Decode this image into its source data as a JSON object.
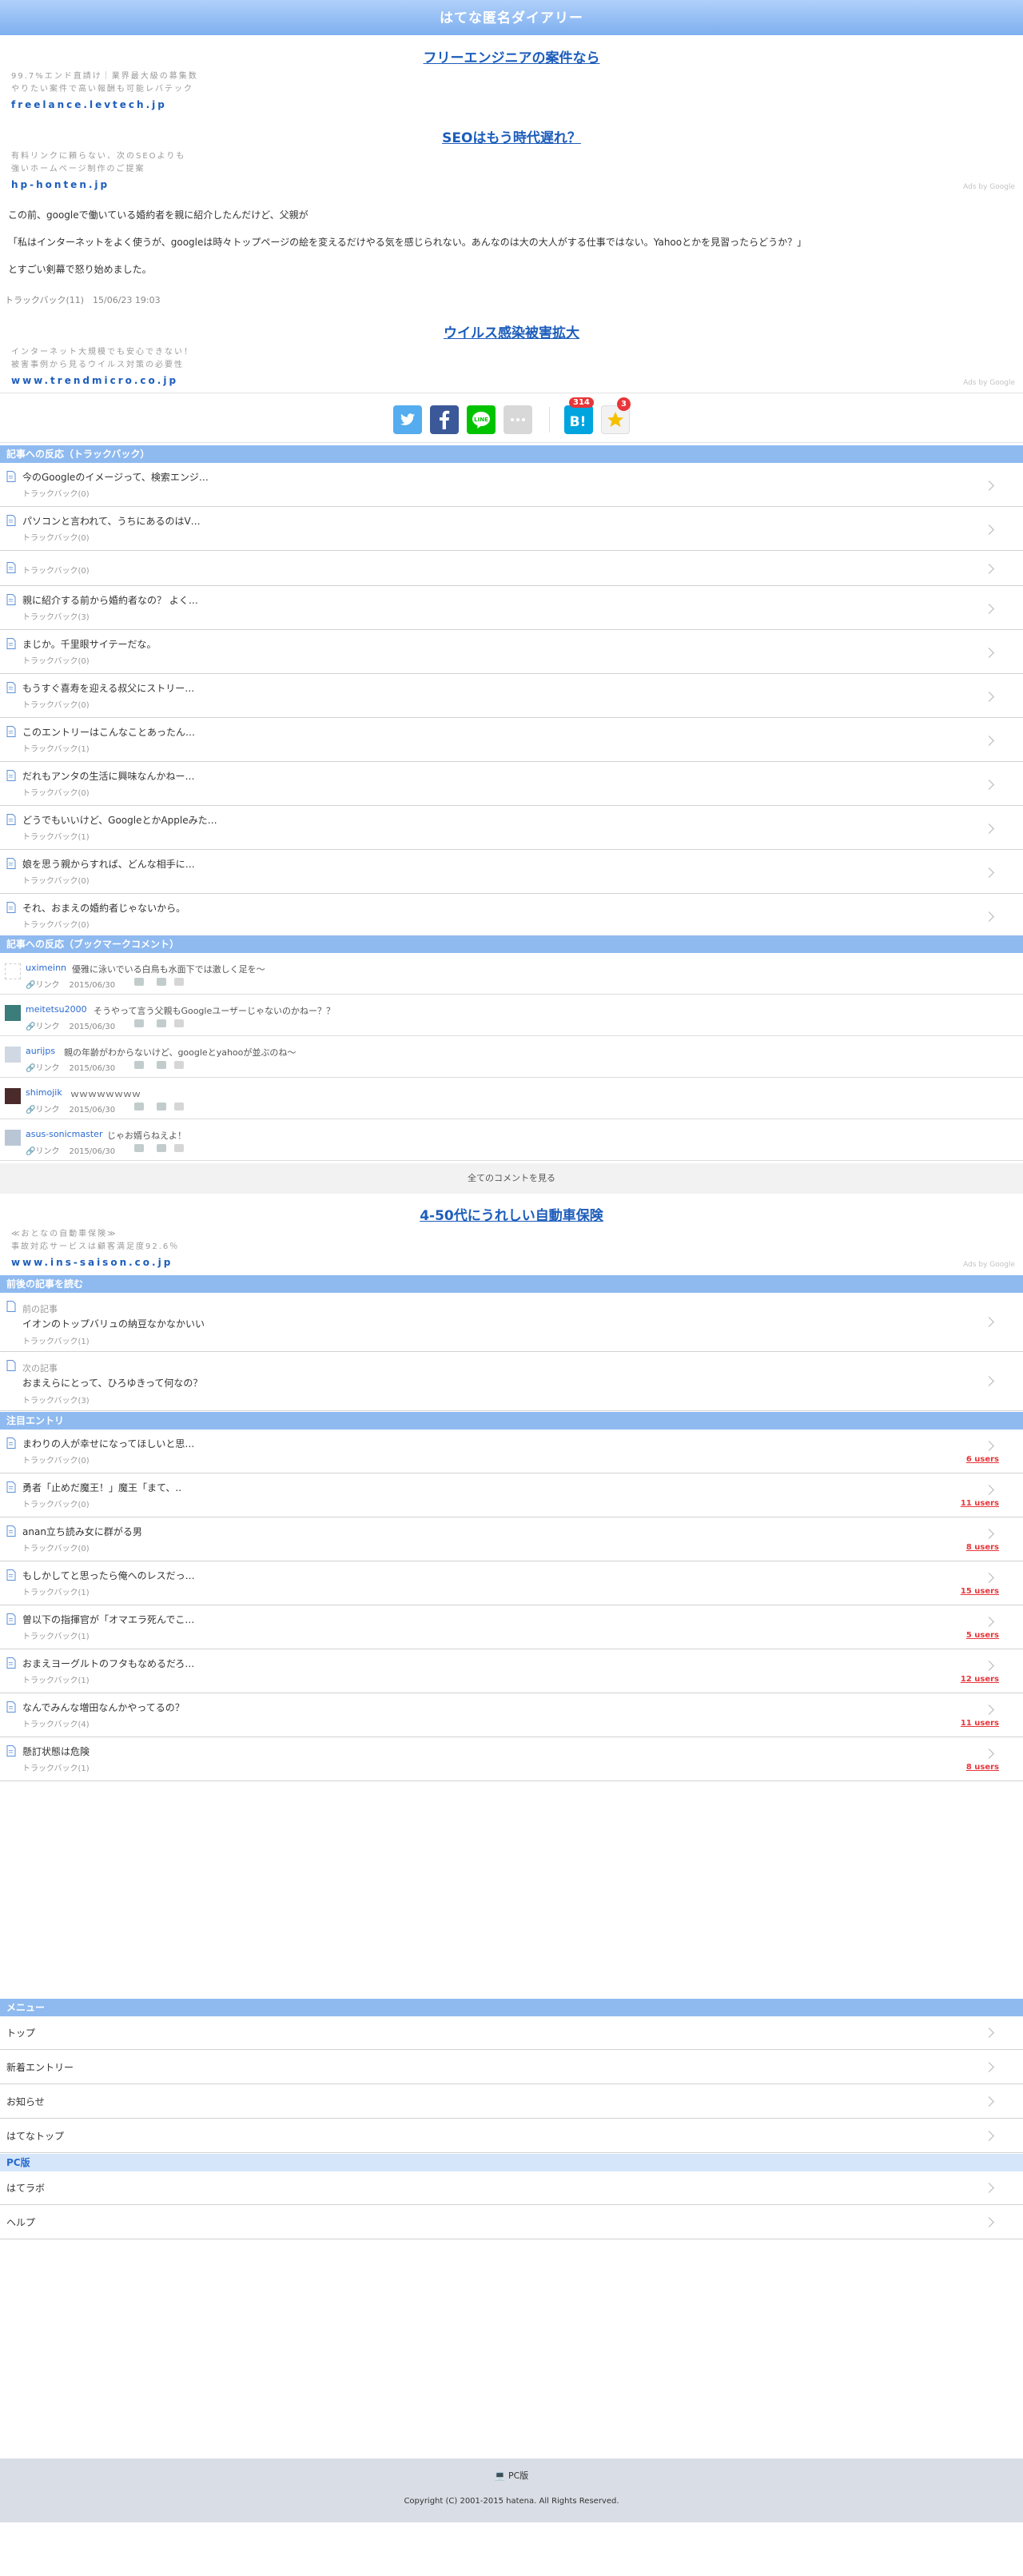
{
  "header": {
    "title": "はてな匿名ダイアリー"
  },
  "ads": [
    {
      "title": "フリーエンジニアの案件なら",
      "desc1": "99.7%エンド直請け｜業界最大級の募集数",
      "desc2": "やりたい案件で高い報酬も可能レバテック",
      "url": "freelance.levtech.jp"
    },
    {
      "title": "SEOはもう時代遅れ？",
      "desc1": "有料リンクに頼らない、次のSEOよりも",
      "desc2": "強いホームページ制作のご提案",
      "url": "hp-honten.jp",
      "label": "Ads by Google"
    },
    {
      "title": "ウイルス感染被害拡大",
      "desc1": "インターネット大規模でも安心できない！",
      "desc2": "被害事例から見るウイルス対策の必要性",
      "url": "www.trendmicro.co.jp",
      "label": "Ads by Google"
    },
    {
      "title": "4-50代にうれしい自動車保険",
      "desc1": "≪おとなの自動車保険≫",
      "desc2": "事故対応サービスは顧客満足度92.6％",
      "url": "www.ins-saison.co.jp",
      "label": "Ads by Google"
    }
  ],
  "entry": {
    "p1": "この前、googleで働いている婚約者を親に紹介したんだけど、父親が",
    "p2": "「私はインターネットをよく使うが、googleは時々トップページの絵を変えるだけやる気を感じられない。あんなのは大の大人がする仕事ではない。Yahooとかを見習ったらどうか？」",
    "p3": "とすごい剣幕で怒り始めました。",
    "meta": "トラックバック(11)　15/06/23 19:03"
  },
  "share": {
    "hatena_count": "314",
    "star_count": "3"
  },
  "trackback_section": {
    "heading": "記事への反応（トラックバック）",
    "items": [
      {
        "title": "今のGoogleのイメージって、検索エンジ…",
        "sub": "トラックバック(0)"
      },
      {
        "title": "パソコンと言われて、うちにあるのはV…",
        "sub": "トラックバック(0)"
      },
      {
        "title": "",
        "sub": "トラックバック(0)"
      },
      {
        "title": "親に紹介する前から婚約者なの？ よく…",
        "sub": "トラックバック(3)"
      },
      {
        "title": "まじか。千里眼サイテーだな。",
        "sub": "トラックバック(0)"
      },
      {
        "title": "もうすぐ喜寿を迎える叔父にストリー…",
        "sub": "トラックバック(0)"
      },
      {
        "title": "このエントリーはこんなことあったん…",
        "sub": "トラックバック(1)"
      },
      {
        "title": "だれもアンタの生活に興味なんかねー…",
        "sub": "トラックバック(0)"
      },
      {
        "title": "どうでもいいけど、GoogleとかAppleみた…",
        "sub": "トラックバック(1)"
      },
      {
        "title": "娘を思う親からすれば、どんな相手に…",
        "sub": "トラックバック(0)"
      },
      {
        "title": "それ、おまえの婚約者じゃないから。",
        "sub": "トラックバック(0)"
      }
    ]
  },
  "bookmark_section": {
    "heading": "記事への反応（ブックマークコメント）",
    "link_label": "リンク",
    "items": [
      {
        "user": "uximeinn",
        "comment": "優雅に泳いでいる白鳥も水面下では激しく足を～",
        "date": "2015/06/30"
      },
      {
        "user": "meitetsu2000",
        "comment": "そうやって言う父親もGoogleユーザーじゃないのかねー？？",
        "date": "2015/06/30"
      },
      {
        "user": "aurijps",
        "comment": "親の年齢がわからないけど、googleとyahooが並ぶのね～",
        "date": "2015/06/30"
      },
      {
        "user": "shimojik",
        "comment": "ｗｗｗｗｗｗｗｗ",
        "date": "2015/06/30"
      },
      {
        "user": "asus-sonicmaster",
        "comment": "じゃお婿らねえよ！",
        "date": "2015/06/30"
      }
    ],
    "more": "全てのコメントを見る"
  },
  "nav_section": {
    "heading": "前後の記事を読む",
    "items": [
      {
        "label": "前の記事",
        "title": "イオンのトップバリュの納豆なかなかいい",
        "sub": "トラックバック(1)"
      },
      {
        "label": "次の記事",
        "title": "おまえらにとって、ひろゆきって何なの？",
        "sub": "トラックバック(3)"
      }
    ]
  },
  "hot_section": {
    "heading": "注目エントリ",
    "items": [
      {
        "title": "まわりの人が幸せになってほしいと思…",
        "sub": "トラックバック(0)",
        "users": "6 users"
      },
      {
        "title": "勇者「止めだ魔王！」魔王「まて、..",
        "sub": "トラックバック(0)",
        "users": "11 users"
      },
      {
        "title": "anan立ち読み女に群がる男",
        "sub": "トラックバック(0)",
        "users": "8 users"
      },
      {
        "title": "もしかしてと思ったら俺へのレスだっ…",
        "sub": "トラックバック(1)",
        "users": "15 users"
      },
      {
        "title": "曽以下の指揮官が「オマエラ死んでこ…",
        "sub": "トラックバック(1)",
        "users": "5 users"
      },
      {
        "title": "おまえヨーグルトのフタもなめるだろ…",
        "sub": "トラックバック(1)",
        "users": "12 users"
      },
      {
        "title": "なんでみんな増田なんかやってるの？",
        "sub": "トラックバック(4)",
        "users": "11 users"
      },
      {
        "title": "懸訂状態は危険",
        "sub": "トラックバック(1)",
        "users": "8 users"
      }
    ]
  },
  "menu": {
    "heading": "メニュー",
    "items": [
      "トップ",
      "新着エントリー",
      "お知らせ",
      "はてなトップ"
    ],
    "pc_heading": "PC版",
    "pc_items": [
      "はてラボ",
      "ヘルプ"
    ]
  },
  "footer": {
    "pc_link": "PC版",
    "copyright": "Copyright (C) 2001-2015 hatena. All Rights Reserved."
  },
  "colors": {
    "header": "#8fbaf0",
    "link": "#1d5dbb",
    "users": "#e8363a"
  }
}
